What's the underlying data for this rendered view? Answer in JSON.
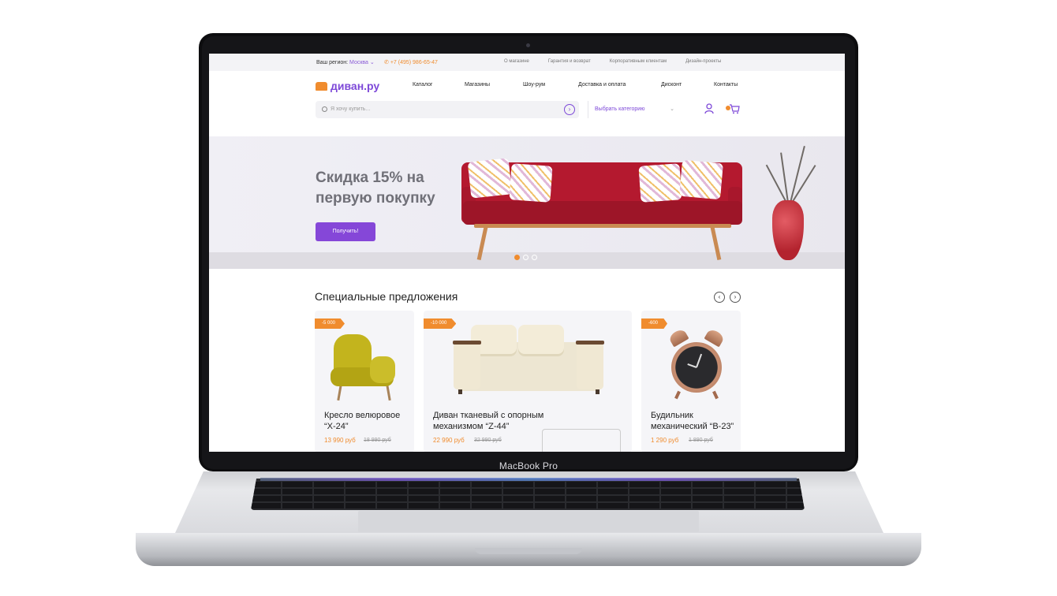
{
  "device": {
    "brand": "MacBook Pro"
  },
  "topbar": {
    "region_label": "Ваш регион:",
    "region_city": "Москва",
    "phone": "+7 (495) 986-65-47",
    "links": [
      "О магазине",
      "Гарантия и возврат",
      "Корпоративным клиентам",
      "Дизайн-проекты"
    ]
  },
  "header": {
    "logo": "диван.ру",
    "nav": [
      "Каталог",
      "Магазины",
      "Шоу-рум",
      "Доставка и оплата",
      "Дисконт",
      "Контакты"
    ],
    "search": {
      "placeholder": "Я хочу купить..."
    },
    "category_select": {
      "value": "Выбрать категорию"
    }
  },
  "hero": {
    "title": "Скидка 15% на первую покупку",
    "button": "Получить!",
    "slides": 3,
    "active_slide": 1
  },
  "specials": {
    "title": "Специальные предложения",
    "products": [
      {
        "badge": "-5 000",
        "name": "Кресло велюровое “X-24”",
        "price": "13 990 руб",
        "old_price": "18 990 руб"
      },
      {
        "badge": "-10 000",
        "name": "Диван тканевый с опорным механизмом “Z-44”",
        "price": "22 990 руб",
        "old_price": "32 990 руб"
      },
      {
        "badge": "-600",
        "name": "Будильник механический “B-23”",
        "price": "1 290 руб",
        "old_price": "1 890 руб"
      }
    ]
  },
  "colors": {
    "accent": "#8547d8",
    "orange": "#f08c2e",
    "sofa_red": "#b4192f"
  }
}
